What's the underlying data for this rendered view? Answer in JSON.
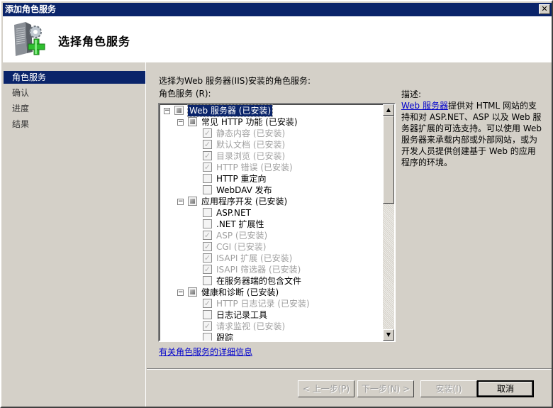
{
  "window": {
    "title": "添加角色服务",
    "close_icon": "✕"
  },
  "header": {
    "title": "选择角色服务",
    "icon": "server-add-icon"
  },
  "sidebar": {
    "items": [
      {
        "label": "角色服务",
        "active": true
      },
      {
        "label": "确认",
        "active": false
      },
      {
        "label": "进度",
        "active": false
      },
      {
        "label": "结果",
        "active": false
      }
    ]
  },
  "main": {
    "instruction": "选择为Web 服务器(IIS)安装的角色服务:",
    "tree_label": "角色服务 (R):",
    "tree": [
      {
        "label": "Web 服务器  (已安装)",
        "level": 0,
        "state": "partial",
        "expander": "⊟",
        "disabled": false,
        "selected": true
      },
      {
        "label": "常见 HTTP 功能  (已安装)",
        "level": 1,
        "state": "partial",
        "expander": "⊟",
        "disabled": false
      },
      {
        "label": "静态内容  (已安装)",
        "level": 2,
        "state": "checked",
        "disabled": true
      },
      {
        "label": "默认文档  (已安装)",
        "level": 2,
        "state": "checked",
        "disabled": true
      },
      {
        "label": "目录浏览  (已安装)",
        "level": 2,
        "state": "checked",
        "disabled": true
      },
      {
        "label": "HTTP 错误  (已安装)",
        "level": 2,
        "state": "checked",
        "disabled": true
      },
      {
        "label": "HTTP 重定向",
        "level": 2,
        "state": "unchecked",
        "disabled": false
      },
      {
        "label": "WebDAV 发布",
        "level": 2,
        "state": "unchecked",
        "disabled": false
      },
      {
        "label": "应用程序开发  (已安装)",
        "level": 1,
        "state": "partial",
        "expander": "⊟",
        "disabled": false
      },
      {
        "label": "ASP.NET",
        "level": 2,
        "state": "unchecked",
        "disabled": false
      },
      {
        "label": ".NET 扩展性",
        "level": 2,
        "state": "unchecked",
        "disabled": false
      },
      {
        "label": "ASP  (已安装)",
        "level": 2,
        "state": "checked",
        "disabled": true
      },
      {
        "label": "CGI  (已安装)",
        "level": 2,
        "state": "checked",
        "disabled": true
      },
      {
        "label": "ISAPI 扩展  (已安装)",
        "level": 2,
        "state": "checked",
        "disabled": true
      },
      {
        "label": "ISAPI 筛选器  (已安装)",
        "level": 2,
        "state": "checked",
        "disabled": true
      },
      {
        "label": "在服务器端的包含文件",
        "level": 2,
        "state": "unchecked",
        "disabled": false
      },
      {
        "label": "健康和诊断  (已安装)",
        "level": 1,
        "state": "partial",
        "expander": "⊟",
        "disabled": false
      },
      {
        "label": "HTTP 日志记录  (已安装)",
        "level": 2,
        "state": "checked",
        "disabled": true
      },
      {
        "label": "日志记录工具",
        "level": 2,
        "state": "unchecked",
        "disabled": false
      },
      {
        "label": "请求监视  (已安装)",
        "level": 2,
        "state": "checked",
        "disabled": true
      },
      {
        "label": "跟踪",
        "level": 2,
        "state": "unchecked",
        "disabled": false
      }
    ],
    "description_label": "描述:",
    "description_link": "Web 服务器",
    "description_text": "提供对 HTML 网站的支持和对 ASP.NET、ASP 以及 Web 服务器扩展的可选支持。可以使用 Web 服务器来承载内部或外部网站，或为开发人员提供创建基于 Web 的应用程序的环境。",
    "more_info_link": "有关角色服务的详细信息"
  },
  "buttons": {
    "previous": "< 上一步(P)",
    "next": "下一步(N) >",
    "install": "安装(I)",
    "cancel": "取消"
  },
  "scrollbar": {
    "up_icon": "▲",
    "down_icon": "▼",
    "position_fraction": 0.0
  }
}
